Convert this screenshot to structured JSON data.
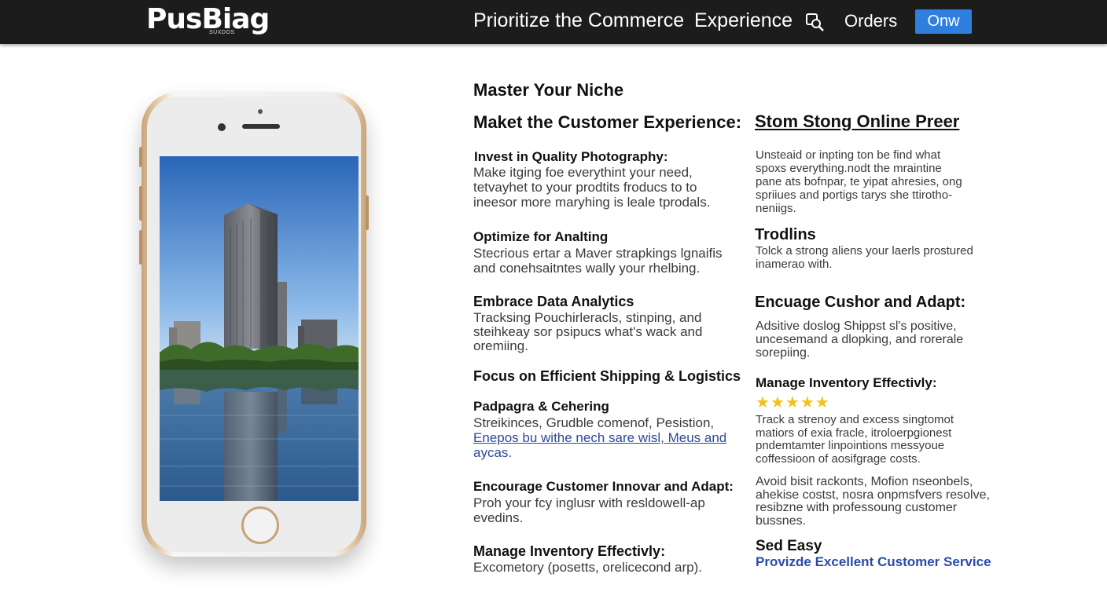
{
  "header": {
    "logo": "PusBiag",
    "logo_sub": "SUXDOS",
    "title": "Prioritize the Commerce",
    "experience": "Experience",
    "orders": "Orders",
    "cta": "Onw",
    "colors": {
      "bar": "#1c1c1c",
      "cta": "#2f7fe0"
    }
  },
  "phone": {
    "screen_image": "building-reflection-photo",
    "frame_color": "#c9a57a"
  },
  "left_column": {
    "kicker": "Master Your Niche",
    "heading": "Maket the Customer Experience:",
    "sections": [
      {
        "title": "Invest in Quality Photography:",
        "lines": [
          "Make itging foe everythint your need,",
          "tetvayhet to your prodtits froducs to to",
          "ineesor more maryhing is leale tprodals."
        ]
      },
      {
        "title": "Optimize for Analting",
        "lines": [
          "Stecrious ertar a Maver strapkings lgnaifis",
          "and conehsaitntes wally your rhelbing."
        ]
      },
      {
        "title": "Embrace Data Analytics",
        "lines": [
          "Tracksing Pouchirleracls, stinping, and",
          "steihkeay sor psipucs what's wack and",
          "oremiing."
        ]
      },
      {
        "title": "Focus on Efficient Shipping & Logistics",
        "lines": []
      },
      {
        "title": "Padpagra & Cehering",
        "lines": [
          "Streikinces, Grudble comenof, Pesistion,",
          "Enepos bu withe nech sare wisl, Meus and",
          "aycas."
        ]
      },
      {
        "title": "Encourage Customer Innovar and Adapt:",
        "lines": [
          "Proh your fcy inglusr with resldowell-ap",
          "evedins."
        ]
      },
      {
        "title": "Manage Inventory Effectivly:",
        "lines": [
          "Excometory (posetts, orelicecond arp)."
        ]
      }
    ]
  },
  "right_column": {
    "heading": "Stom Stong Online Preer",
    "intro_lines": [
      "Unsteaid or inpting ton be find what",
      "spoxs everything.nodt the mraintine",
      "pane ats bofnpar, te yipat ahresies, ong",
      "spriiues and portigs tarys she ttirotho-",
      "neniigs."
    ],
    "sections": [
      {
        "title": "Trodlins",
        "lines": [
          "Tolck a strong aliens your laerls prostured",
          "inamerao with."
        ]
      },
      {
        "title": "Encuage Cushor and Adapt:",
        "lines": [
          "Adsitive doslog Shippst sl's positive,",
          "uncesemand a dlopking, and rorerale",
          "sorepiing."
        ]
      },
      {
        "title": "Manage Inventory Effectivly:",
        "stars": 5,
        "lines": [
          "Track a strenoy and excess singtomot",
          "matiors of exia fracle, itroloerpgionest",
          "pndemtamter linpointions messyoue",
          "coffessioon of aosifgrage costs."
        ],
        "lines2": [
          "Avoid bisit rackonts, Mofion nseonbels,",
          "ahekise costst, nosra onpmsfvers resolve,",
          "resibzne with professoung customer",
          "bussnes."
        ]
      },
      {
        "title": "Sed Easy",
        "link": "Provizde Excellent Customer Service"
      }
    ]
  }
}
